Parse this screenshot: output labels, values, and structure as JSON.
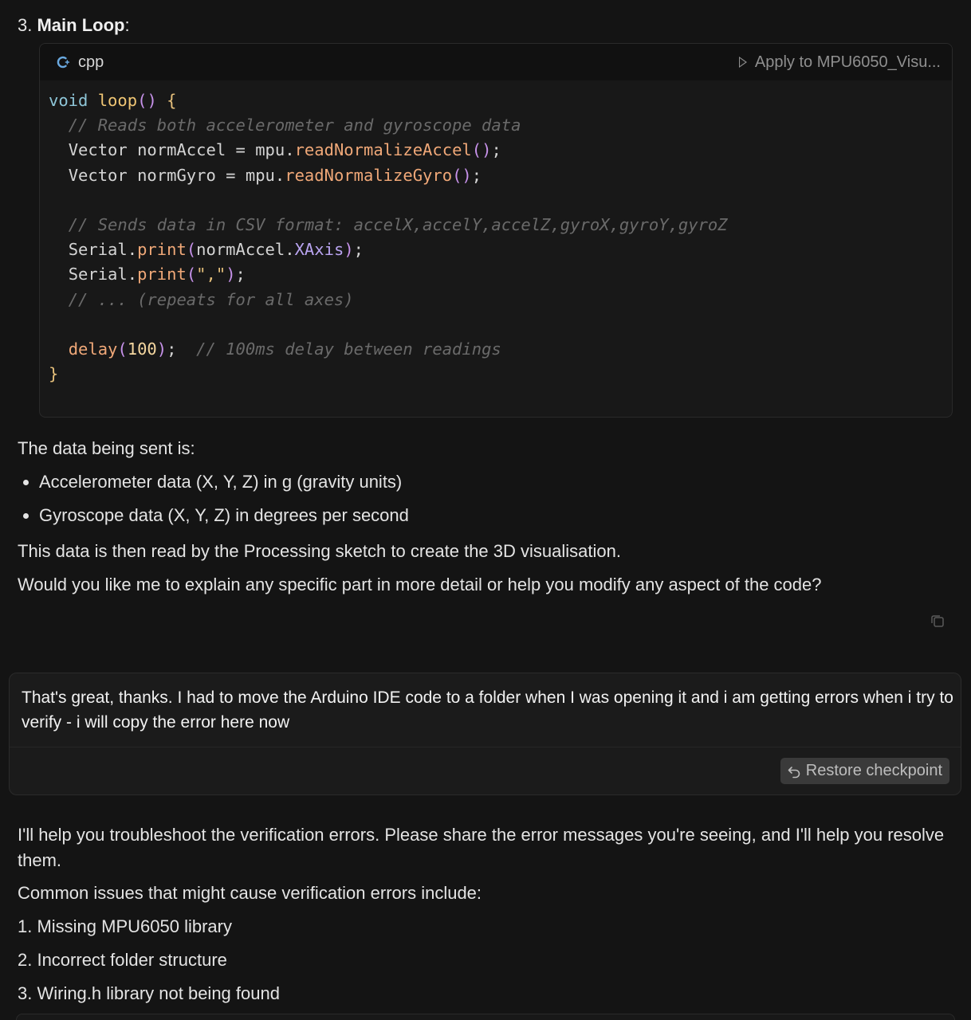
{
  "section": {
    "number": "3.",
    "title": "Main Loop",
    "colon": ":"
  },
  "code_block": {
    "language": "cpp",
    "apply_label": "Apply to MPU6050_Visu...",
    "lines": [
      "void loop() {",
      "  // Reads both accelerometer and gyroscope data",
      "  Vector normAccel = mpu.readNormalizeAccel();",
      "  Vector normGyro = mpu.readNormalizeGyro();",
      "",
      "  // Sends data in CSV format: accelX,accelY,accelZ,gyroX,gyroY,gyroZ",
      "  Serial.print(normAccel.XAxis);",
      "  Serial.print(\",\");",
      "  // ... (repeats for all axes)",
      "",
      "  delay(100);  // 100ms delay between readings",
      "}"
    ]
  },
  "assistant_1": {
    "intro": "The data being sent is:",
    "bullets": [
      "Accelerometer data (X, Y, Z) in g (gravity units)",
      "Gyroscope data (X, Y, Z) in degrees per second"
    ],
    "para_1": "This data is then read by the Processing sketch to create the 3D visualisation.",
    "para_2": "Would you like me to explain any specific part in more detail or help you modify any aspect of the code?"
  },
  "user_message": {
    "text": "That's great, thanks. I had to move the Arduino IDE code to a folder when I was opening it and i am getting errors when i try to verify  - i will copy the error here now",
    "restore_label": "Restore checkpoint"
  },
  "assistant_2": {
    "para_1": "I'll help you troubleshoot the verification errors. Please share the error messages you're seeing, and I'll help you resolve them.",
    "para_2": "Common issues that might cause verification errors include:",
    "items": [
      "1. Missing MPU6050 library",
      "2. Incorrect folder structure",
      "3. Wiring.h library not being found"
    ]
  },
  "icons": {
    "language": "cpp-language-icon",
    "apply": "play-icon",
    "copy": "copy-icon",
    "restore": "undo-icon"
  }
}
